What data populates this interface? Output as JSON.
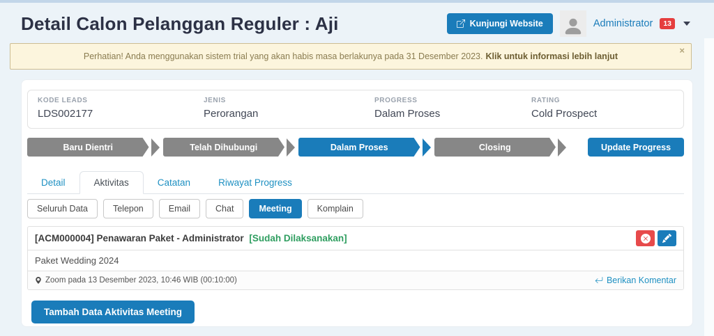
{
  "header": {
    "title": "Detail Calon Pelanggan Reguler : Aji",
    "visit_website_label": "Kunjungi Website",
    "username": "Administrator",
    "notification_count": "13"
  },
  "alert": {
    "message": "Perhatian! Anda menggunakan sistem trial yang akan habis masa berlakunya pada 31 Desember 2023.",
    "link_text": "Klik untuk informasi lebih lanjut",
    "close_glyph": "×"
  },
  "lead": {
    "fields": [
      {
        "label": "KODE LEADS",
        "value": "LDS002177"
      },
      {
        "label": "JENIS",
        "value": "Perorangan"
      },
      {
        "label": "PROGRESS",
        "value": "Dalam Proses"
      },
      {
        "label": "RATING",
        "value": "Cold Prospect"
      }
    ]
  },
  "progress": {
    "steps": [
      {
        "label": "Baru Dientri",
        "active": false
      },
      {
        "label": "Telah Dihubungi",
        "active": false
      },
      {
        "label": "Dalam Proses",
        "active": true
      },
      {
        "label": "Closing",
        "active": false
      }
    ],
    "update_label": "Update Progress"
  },
  "tabs": [
    {
      "label": "Detail",
      "active": false
    },
    {
      "label": "Aktivitas",
      "active": true
    },
    {
      "label": "Catatan",
      "active": false
    },
    {
      "label": "Riwayat Progress",
      "active": false
    }
  ],
  "filters": [
    {
      "label": "Seluruh Data",
      "active": false
    },
    {
      "label": "Telepon",
      "active": false
    },
    {
      "label": "Email",
      "active": false
    },
    {
      "label": "Chat",
      "active": false
    },
    {
      "label": "Meeting",
      "active": true
    },
    {
      "label": "Komplain",
      "active": false
    }
  ],
  "activity": {
    "title": "[ACM000004] Penawaran Paket - Administrator",
    "status": "[Sudah Dilaksanakan]",
    "description": "Paket Wedding 2024",
    "meta": "Zoom pada 13 Desember 2023, 10:46 WIB (00:10:00)",
    "comment_label": "Berikan Komentar"
  },
  "actions": {
    "add_activity_label": "Tambah Data Aktivitas Meeting"
  },
  "colors": {
    "primary_blue": "#1a7cba",
    "link_blue": "#1e90c2",
    "step_gray": "#878787",
    "status_green": "#2f9e60",
    "delete_red": "#e74a4b",
    "badge_red": "#e53e3e",
    "banner_bg": "#fcf5dd",
    "banner_border": "#cdbd92",
    "page_bg": "#ecf3f8"
  }
}
